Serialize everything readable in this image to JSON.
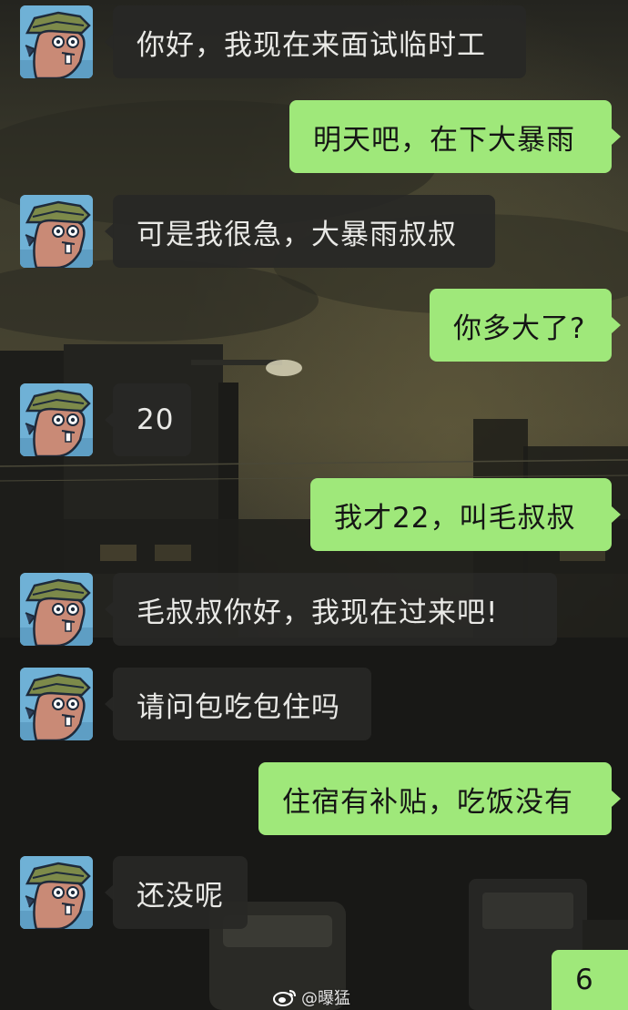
{
  "messages": [
    {
      "side": "left",
      "text": "你好，我现在来面试临时工"
    },
    {
      "side": "right",
      "text": "明天吧，在下大暴雨"
    },
    {
      "side": "left",
      "text": "可是我很急，大暴雨叔叔"
    },
    {
      "side": "right",
      "text": "你多大了?"
    },
    {
      "side": "left",
      "text": "20"
    },
    {
      "side": "right",
      "text": "我才22，叫毛叔叔"
    },
    {
      "side": "left",
      "text": "毛叔叔你好，我现在过来吧!"
    },
    {
      "side": "left",
      "text": "请问包吃包住吗"
    },
    {
      "side": "right",
      "text": "住宿有补贴，吃饭没有"
    },
    {
      "side": "left",
      "text": "还没呢"
    },
    {
      "side": "right",
      "text": "6"
    }
  ],
  "watermark": {
    "text": "@曝猛",
    "icon": "weibo-logo-icon"
  },
  "colors": {
    "right_bubble": "#9fe87a",
    "left_bubble": "#282826",
    "avatar_bg": "#6fb1d6"
  }
}
